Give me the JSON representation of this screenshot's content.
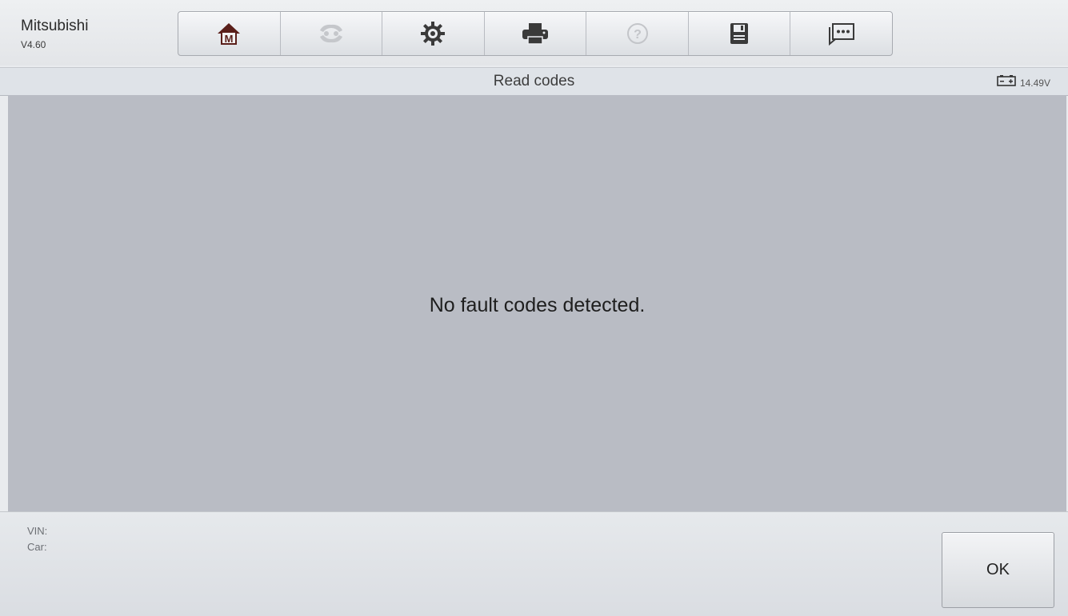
{
  "header": {
    "brand_name": "Mitsubishi",
    "version": "V4.60"
  },
  "toolbar": {
    "buttons": [
      {
        "icon": "home-icon"
      },
      {
        "icon": "vehicle-swap-icon"
      },
      {
        "icon": "gear-icon"
      },
      {
        "icon": "printer-icon"
      },
      {
        "icon": "help-icon"
      },
      {
        "icon": "save-icon"
      },
      {
        "icon": "chat-icon"
      }
    ]
  },
  "titlebar": {
    "title": "Read codes",
    "battery_voltage": "14.49V"
  },
  "main": {
    "message": "No fault codes detected."
  },
  "footer": {
    "vin_label": "VIN:",
    "car_label": "Car:",
    "ok_label": "OK"
  },
  "colors": {
    "content_bg": "#b9bcc4",
    "toolbar_bg": "#e6e8eb"
  }
}
